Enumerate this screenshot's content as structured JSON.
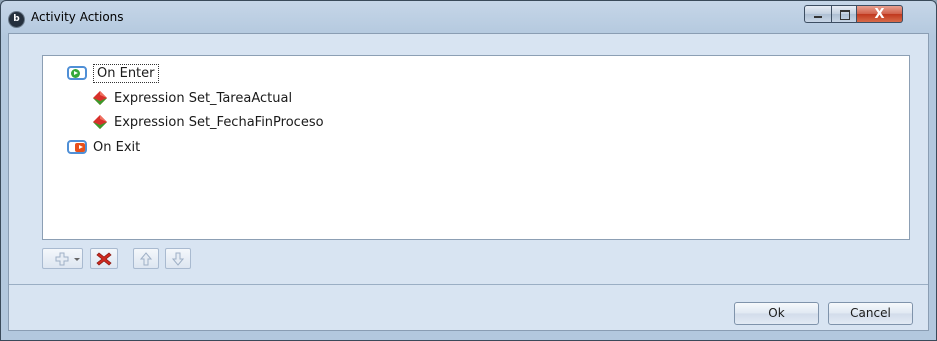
{
  "window": {
    "title": "Activity Actions",
    "app_icon": "b-logo-icon",
    "close_glyph": "X"
  },
  "tree": {
    "nodes": [
      {
        "label": "On Enter",
        "icon": "on-enter-icon",
        "level": 0,
        "focused": true
      },
      {
        "label": "Expression Set_TareaActual",
        "icon": "expression-icon",
        "level": 1
      },
      {
        "label": "Expression Set_FechaFinProceso",
        "icon": "expression-icon",
        "level": 1
      },
      {
        "label": "On Exit",
        "icon": "on-exit-icon",
        "level": 0
      }
    ]
  },
  "toolbar": {
    "buttons": [
      {
        "name": "add",
        "icon": "add-icon",
        "has_dropdown": true
      },
      {
        "name": "delete",
        "icon": "delete-icon"
      },
      {
        "name": "move-up",
        "icon": "arrow-up-icon"
      },
      {
        "name": "move-down",
        "icon": "arrow-down-icon"
      }
    ]
  },
  "buttons": {
    "ok_label": "Ok",
    "cancel_label": "Cancel"
  },
  "colors": {
    "frame": "#b3c8de",
    "panel": "#d8e4f2",
    "on_enter_green": "#36a83a",
    "on_exit_orange": "#e8501a",
    "expression_red": "#d8302a",
    "expression_green": "#3a9a2a",
    "delete_red": "#d0281e"
  }
}
